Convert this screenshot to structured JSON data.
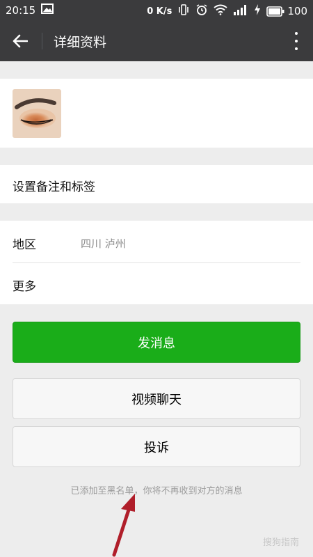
{
  "status_bar": {
    "time": "20:15",
    "speed": "0 K/s",
    "battery": "100"
  },
  "header": {
    "title": "详细资料"
  },
  "profile": {
    "avatar": "avatar"
  },
  "remark": {
    "label": "设置备注和标签"
  },
  "info": {
    "region_label": "地区",
    "region_value": "四川  泸州",
    "more_label": "更多"
  },
  "actions": {
    "send_message": "发消息",
    "video_chat": "视频聊天",
    "report": "投诉"
  },
  "notice": "已添加至黑名单，你将不再收到对方的消息",
  "watermark": "搜狗指南",
  "colors": {
    "bar": "#3b3b3d",
    "primary": "#1aad19",
    "background": "#ededed",
    "arrow": "#b01e2a"
  }
}
